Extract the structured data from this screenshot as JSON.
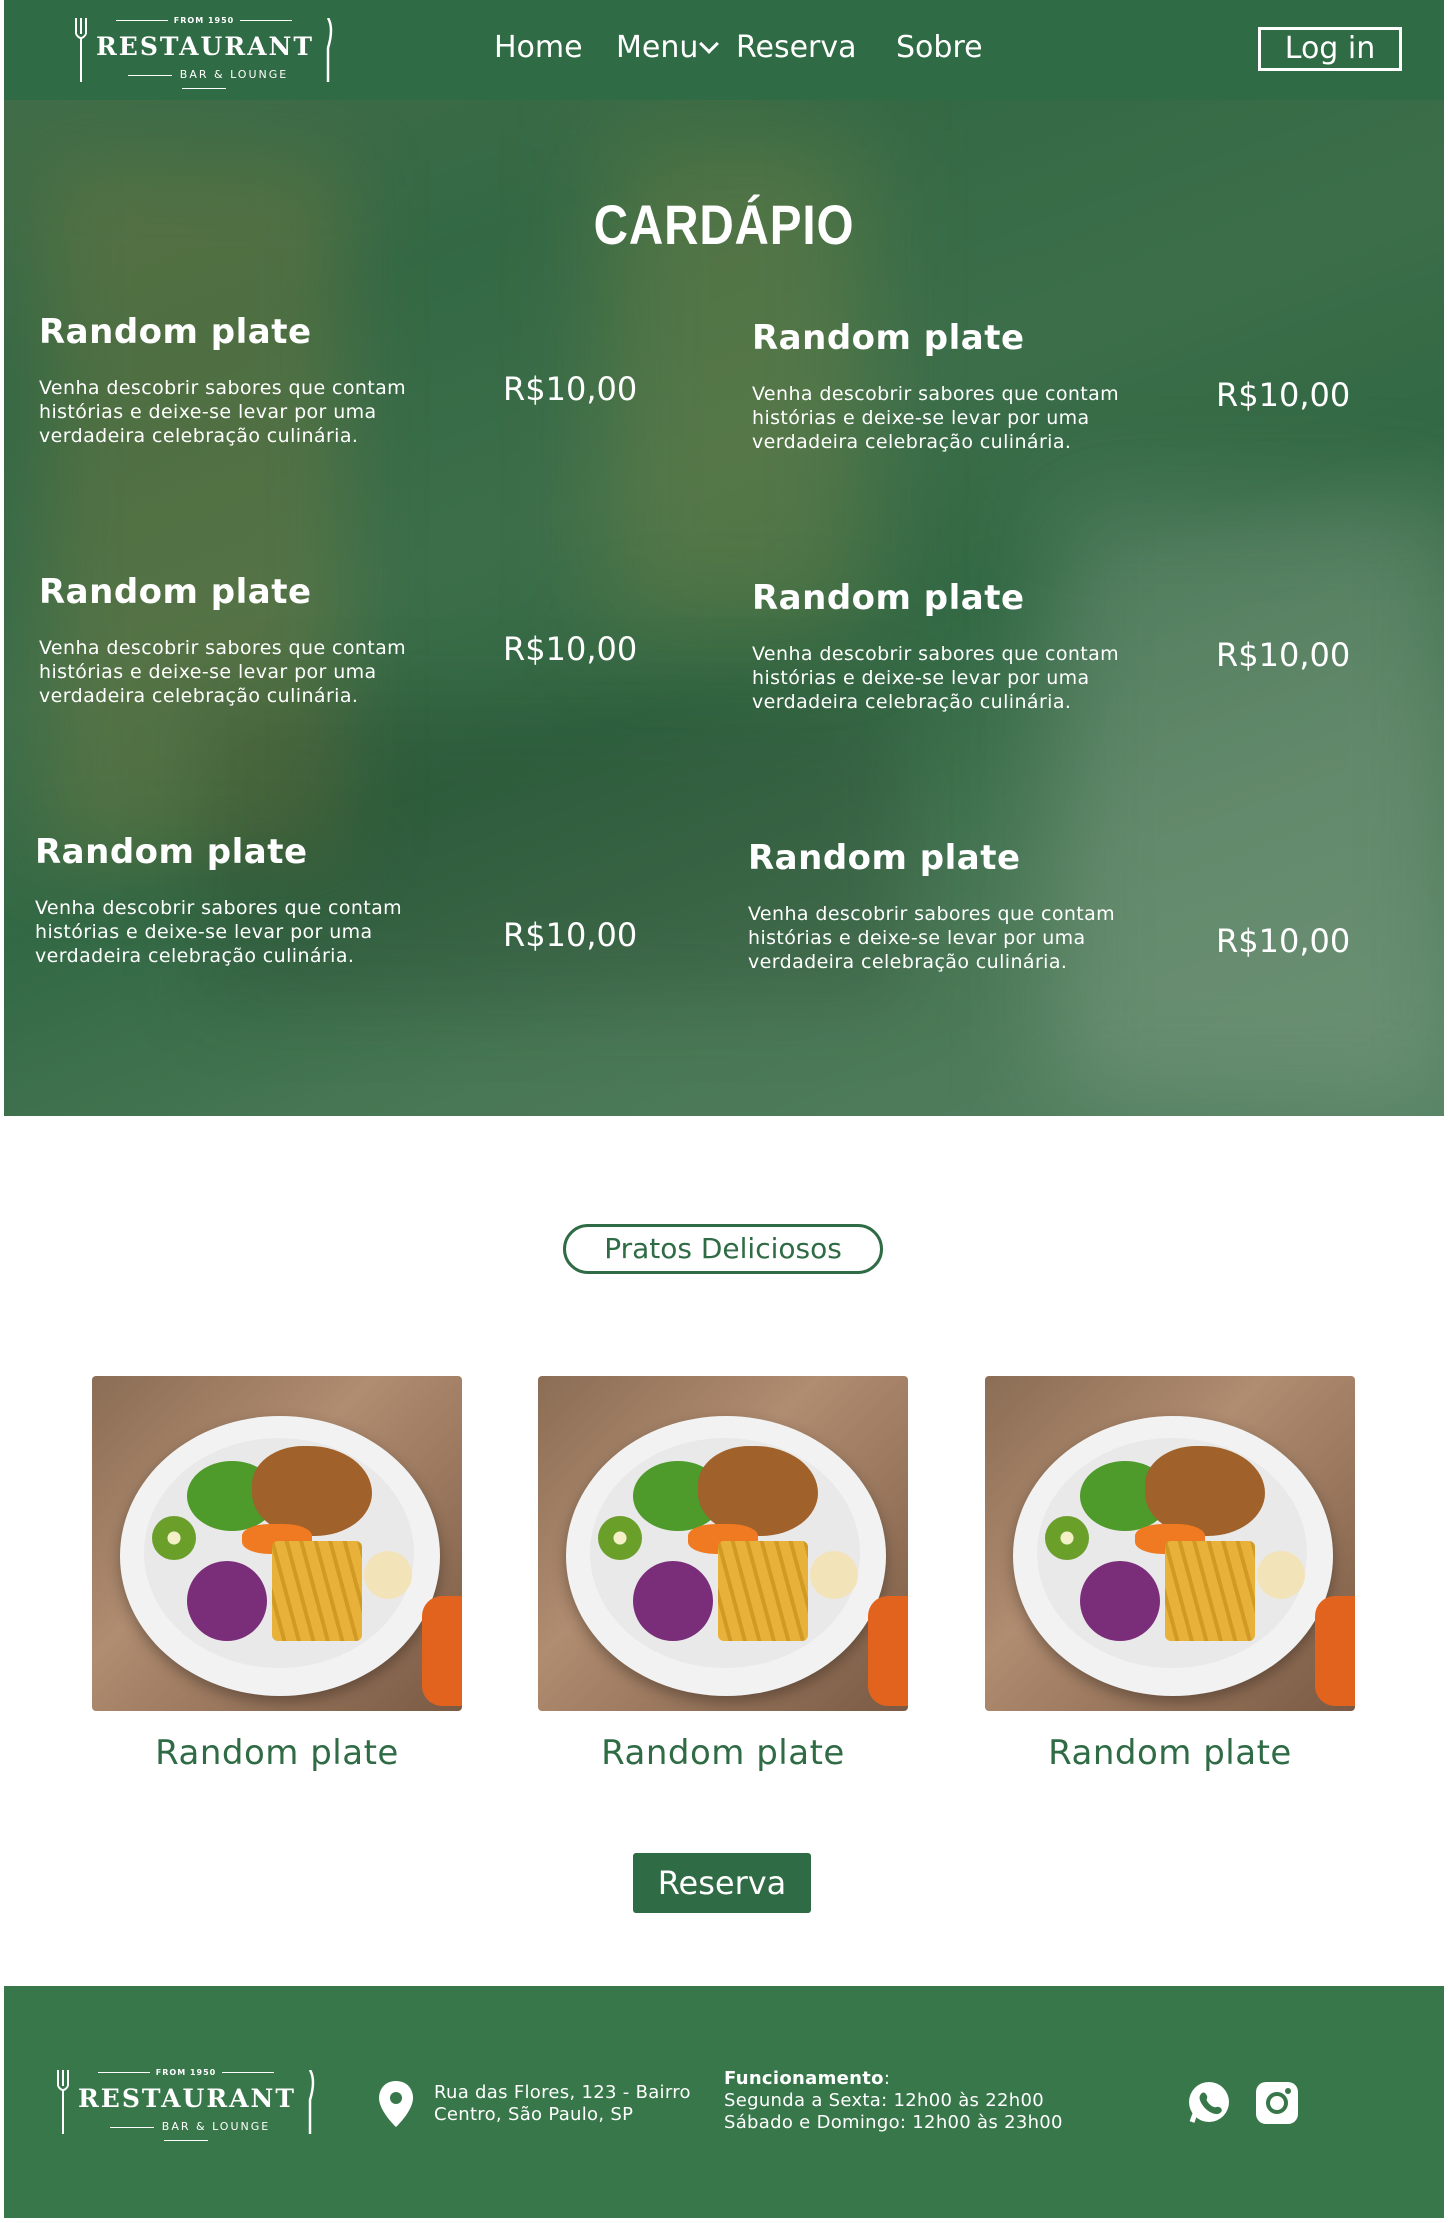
{
  "header": {
    "logo": {
      "from": "FROM 1950",
      "name": "RESTAURANT",
      "sub": "BAR & LOUNGE"
    },
    "nav": {
      "home": "Home",
      "menu": "Menu",
      "reserva": "Reserva",
      "sobre": "Sobre"
    },
    "login_label": "Log in"
  },
  "hero": {
    "title": "CARDÁPIO",
    "items": [
      {
        "name": "Random plate",
        "description": "Venha descobrir sabores que contam histórias e deixe-se levar por uma verdadeira celebração culinária.",
        "price": "R$10,00"
      },
      {
        "name": "Random plate",
        "description": "Venha descobrir sabores que contam histórias e deixe-se levar por uma verdadeira celebração culinária.",
        "price": "R$10,00"
      },
      {
        "name": "Random plate",
        "description": "Venha descobrir sabores que contam histórias e deixe-se levar por uma verdadeira celebração culinária.",
        "price": "R$10,00"
      },
      {
        "name": "Random plate",
        "description": "Venha descobrir sabores que contam histórias e deixe-se levar por uma verdadeira celebração culinária.",
        "price": "R$10,00"
      },
      {
        "name": "Random plate",
        "description": "Venha descobrir sabores que contam histórias e deixe-se levar por uma verdadeira celebração culinária.",
        "price": "R$10,00"
      },
      {
        "name": "Random plate",
        "description": "Venha descobrir sabores que contam histórias e deixe-se levar por uma verdadeira celebração culinária.",
        "price": "R$10,00"
      }
    ]
  },
  "pratos": {
    "badge": "Pratos Deliciosos",
    "dishes": [
      {
        "name": "Random plate"
      },
      {
        "name": "Random plate"
      },
      {
        "name": "Random plate"
      }
    ],
    "reserva_label": "Reserva"
  },
  "footer": {
    "logo": {
      "from": "FROM 1950",
      "name": "RESTAURANT",
      "sub": "BAR & LOUNGE"
    },
    "address_line1": "Rua das Flores, 123 - Bairro",
    "address_line2": "Centro, São Paulo, SP",
    "hours_title": "Funcionamento",
    "hours_colon": ":",
    "hours_line1": "Segunda a Sexta: 12h00 às 22h00",
    "hours_line2": "Sábado e Domingo: 12h00 às 23h00"
  },
  "icons": {
    "location": "map-pin-icon",
    "whatsapp": "whatsapp-icon",
    "instagram": "instagram-icon",
    "chevron": "chevron-down-icon"
  },
  "colors": {
    "brand_green": "#2f6b44",
    "footer_green": "#37774a",
    "white": "#ffffff"
  }
}
